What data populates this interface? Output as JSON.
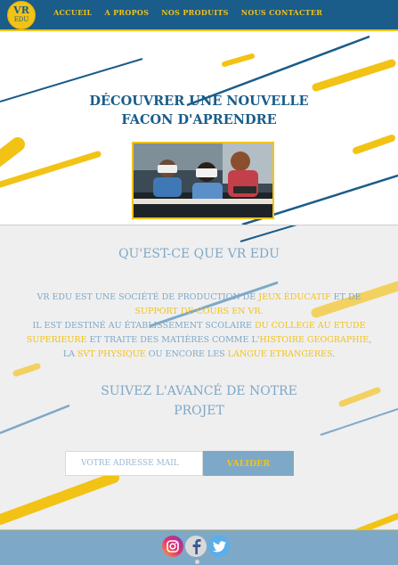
{
  "logo": {
    "line1": "VR",
    "line2": "EDU"
  },
  "nav": {
    "links": [
      "ACCUEIL",
      "A PROPOS",
      "NOS PRODUITS",
      "NOUS CONTACTER"
    ]
  },
  "hero": {
    "title_line1": "DÉCOUVRER UNE NOUVELLE",
    "title_line2": "FACON D'APRENDRE"
  },
  "about": {
    "title": "QU'EST-CE QUE VR EDU",
    "p1_a": "VR EDU EST UNE SOCIÉTÉ DE PRODUCTION DE ",
    "p1_h1": "JEUX ÉDUCATIF",
    "p1_b": " ET DE ",
    "p1_h2": "SUPPORT DE COURS EN VR.",
    "p2_a": "IL EST DESTINÉ AU ÉTABLISSEMENT SCOLAIRE ",
    "p2_h1": "DU COLLEGE AU ETUDE SUPERIEURE",
    "p2_b": " ET TRAITE DES MATIÈRES COMME L'",
    "p2_h2": "HISTOIRE GEOGRAPHIE",
    "p2_c": ",",
    "p3_a": "LA ",
    "p3_h1": "SVT PHYSIQUE",
    "p3_b": " OU ENCORE LES ",
    "p3_h2": "LANGUE ETRANGERES",
    "p3_c": "."
  },
  "follow": {
    "title_line1": "SUIVEZ L'AVANCÉ DE NOTRE",
    "title_line2": "PROJET"
  },
  "form": {
    "email_placeholder": "VOTRE ADRESSE MAIL",
    "submit_label": "VALIDER"
  },
  "footer": {
    "icons": [
      "instagram-icon",
      "facebook-icon",
      "twitter-icon"
    ]
  },
  "colors": {
    "nav_bg": "#1a5c8a",
    "accent_yellow": "#f2c315",
    "light_blue": "#7ea8c8",
    "section_bg": "#efefef"
  }
}
